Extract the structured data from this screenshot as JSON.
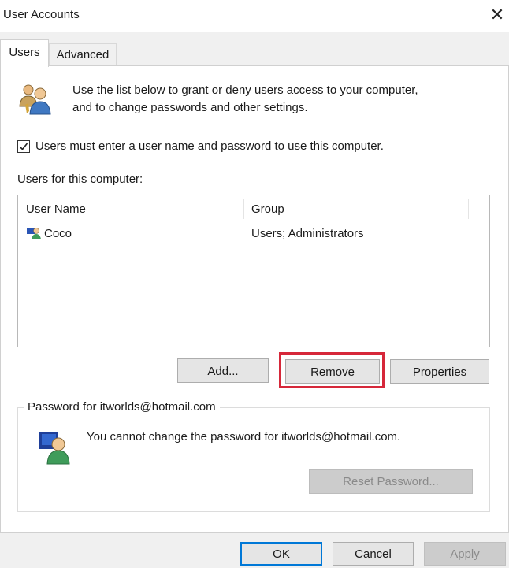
{
  "window": {
    "title": "User Accounts",
    "close_glyph": "✕"
  },
  "tabs": [
    {
      "label": "Users",
      "active": true
    },
    {
      "label": "Advanced",
      "active": false
    }
  ],
  "intro": {
    "icon": "users-icon",
    "line1": "Use the list below to grant or deny users access to your computer,",
    "line2": "and to change passwords and other settings."
  },
  "require_login": {
    "label": "Users must enter a user name and password to use this computer.",
    "checked": true
  },
  "users_section": {
    "label": "Users for this computer:",
    "columns": [
      "User Name",
      "Group"
    ],
    "rows": [
      {
        "user_name": "Coco",
        "group": "Users; Administrators",
        "icon": "user-icon"
      }
    ]
  },
  "buttons": {
    "add": "Add...",
    "remove": "Remove",
    "properties": "Properties"
  },
  "password_group": {
    "label": "Password for itworlds@hotmail.com",
    "message": "You cannot change the password for itworlds@hotmail.com.",
    "reset": "Reset Password...",
    "icon": "user-password-icon"
  },
  "dialog": {
    "ok": "OK",
    "cancel": "Cancel",
    "apply": "Apply"
  },
  "colors": {
    "highlight": "#d6283a",
    "focus": "#0078d7"
  }
}
